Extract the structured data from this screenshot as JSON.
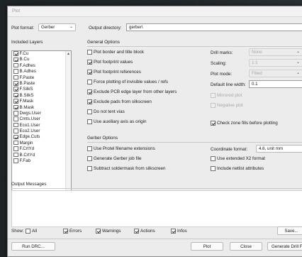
{
  "window": {
    "title": "Plot"
  },
  "top": {
    "plot_format_label": "Plot format:",
    "plot_format_value": "Gerber",
    "output_dir_label": "Output directory:",
    "output_dir_value": "gerber\\"
  },
  "layers": {
    "title": "Included Layers",
    "items": [
      {
        "name": "F.Cu",
        "checked": true
      },
      {
        "name": "B.Cu",
        "checked": true
      },
      {
        "name": "F.Adhes",
        "checked": false
      },
      {
        "name": "B.Adhes",
        "checked": false
      },
      {
        "name": "F.Paste",
        "checked": false
      },
      {
        "name": "B.Paste",
        "checked": true
      },
      {
        "name": "F.SilkS",
        "checked": true
      },
      {
        "name": "B.SilkS",
        "checked": true
      },
      {
        "name": "F.Mask",
        "checked": true
      },
      {
        "name": "B.Mask",
        "checked": true
      },
      {
        "name": "Dwgs.User",
        "checked": false
      },
      {
        "name": "Cmts.User",
        "checked": false
      },
      {
        "name": "Eco1.User",
        "checked": false
      },
      {
        "name": "Eco2.User",
        "checked": false
      },
      {
        "name": "Edge.Cuts",
        "checked": true
      },
      {
        "name": "Margin",
        "checked": false
      },
      {
        "name": "F.CrtYd",
        "checked": false
      },
      {
        "name": "B.CrtYd",
        "checked": false
      },
      {
        "name": "F.Fab",
        "checked": false
      }
    ]
  },
  "general": {
    "title": "General Options",
    "left": [
      {
        "label": "Plot border and title block",
        "checked": false
      },
      {
        "label": "Plot footprint values",
        "checked": true
      },
      {
        "label": "Plot footprint references",
        "checked": true
      },
      {
        "label": "Force plotting of invisible values / refs",
        "checked": false
      },
      {
        "label": "Exclude PCB edge layer from other layers",
        "checked": true
      },
      {
        "label": "Exclude pads from silkscreen",
        "checked": true
      },
      {
        "label": "Do not tent vias",
        "checked": false
      },
      {
        "label": "Use auxiliary axis as origin",
        "checked": false
      }
    ],
    "drill_marks_label": "Drill marks:",
    "drill_marks_value": "None",
    "scaling_label": "Scaling:",
    "scaling_value": "1:1",
    "plot_mode_label": "Plot mode:",
    "plot_mode_value": "Filled",
    "line_width_label": "Default line width:",
    "line_width_value": "0.1",
    "line_width_unit": "m",
    "mirrored_label": "Mirrored plot",
    "negative_label": "Negative plot",
    "check_zone_label": "Check zone fills before plotting",
    "check_zone_checked": true
  },
  "gerber": {
    "title": "Gerber Options",
    "left": [
      {
        "label": "Use Protel filename extensions",
        "checked": false
      },
      {
        "label": "Generate Gerber job file",
        "checked": false
      },
      {
        "label": "Subtract soldermask from silkscreen",
        "checked": false
      }
    ],
    "coord_label": "Coordinate format:",
    "coord_value": "4.6, unit mm",
    "x2_label": "Use extended X2 format",
    "netlist_label": "Include netlist attributes"
  },
  "messages": {
    "title": "Output Messages"
  },
  "show": {
    "label": "Show:",
    "all": "All",
    "errors": "Errors",
    "warnings": "Warnings",
    "actions": "Actions",
    "infos": "Infos",
    "save": "Save..."
  },
  "buttons": {
    "run_drc": "Run DRC...",
    "plot": "Plot",
    "close": "Close",
    "generate_drill": "Generate Drill Files..."
  }
}
